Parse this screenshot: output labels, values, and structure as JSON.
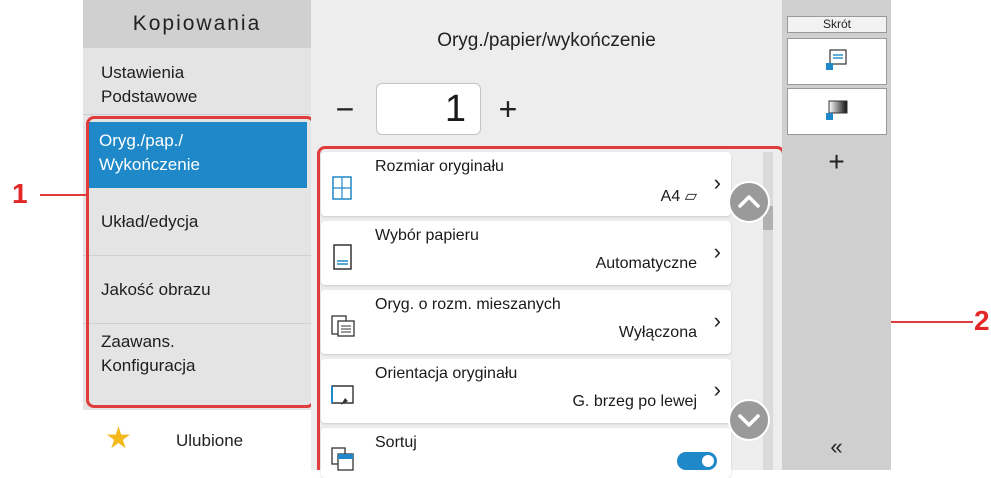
{
  "left_panel": {
    "title": "Kopiowania",
    "tabs": [
      {
        "label": "Ustawienia\nPodstawowe"
      },
      {
        "label": "Oryg./pap./\nWykończenie"
      },
      {
        "label": "Układ/edycja"
      },
      {
        "label": "Jakość obrazu"
      },
      {
        "label": "Zaawans.\nKonfiguracja"
      }
    ],
    "favorites": {
      "label": "Ulubione",
      "icon": "star-icon"
    }
  },
  "center_panel": {
    "title": "Oryg./papier/wykończenie",
    "copies": {
      "value": "1",
      "minus": "−",
      "plus": "+"
    },
    "settings": [
      {
        "label": "Rozmiar oryginału",
        "value": "A4 ⏥",
        "icon": "original-size-icon"
      },
      {
        "label": "Wybór papieru",
        "value": "Automatyczne",
        "icon": "paper-tray-icon"
      },
      {
        "label": "Oryg. o rozm. mieszanych",
        "value": "Wyłączona",
        "icon": "mixed-size-icon"
      },
      {
        "label": "Orientacja oryginału",
        "value": "G. brzeg po lewej",
        "icon": "orientation-icon"
      },
      {
        "label": "Sortuj",
        "value": "",
        "icon": "collate-icon",
        "toggle": true
      }
    ]
  },
  "shortcuts": {
    "title": "Skrót",
    "add": "+",
    "collapse": "«"
  },
  "callouts": {
    "left": "1",
    "right": "2",
    "color": "#e03c3c"
  },
  "colors": {
    "accent": "#1e88c8",
    "star": "#f3b81c",
    "toggle": "#1e88c8"
  }
}
